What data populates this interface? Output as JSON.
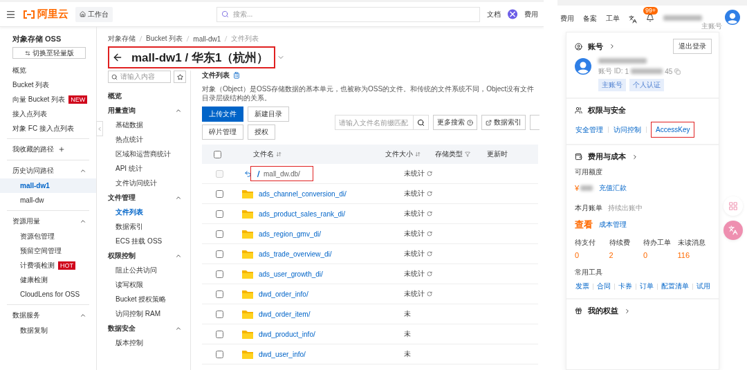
{
  "console": {
    "topbar": {
      "logo": "阿里云",
      "workbench": "工作台",
      "search_placeholder": "搜索...",
      "links": [
        "文档",
        "费用"
      ]
    },
    "sidebar": {
      "title": "对象存储 OSS",
      "switch_button": "切换至轻量版",
      "groups": [
        {
          "kind": "plain",
          "items": [
            {
              "label": "概览",
              "selected": false
            },
            {
              "label": "Bucket 列表",
              "selected": false
            },
            {
              "label": "向量 Bucket 列表",
              "badge": "NEW",
              "selected": false
            },
            {
              "label": "接入点列表",
              "selected": false
            },
            {
              "label": "对象 FC 接入点列表",
              "selected": false
            }
          ]
        },
        {
          "kind": "add",
          "heading": "我收藏的路径"
        },
        {
          "kind": "collapsible",
          "heading": "历史访问路径",
          "expanded": true,
          "items": [
            {
              "label": "mall-dw1",
              "selected": true
            },
            {
              "label": "mall-dw",
              "selected": false
            }
          ]
        },
        {
          "kind": "collapsible",
          "heading": "资源用量",
          "expanded": true,
          "items": [
            {
              "label": "资源包管理",
              "selected": false
            },
            {
              "label": "预留空间管理",
              "selected": false
            },
            {
              "label": "计费项检测",
              "badge": "HOT",
              "selected": false
            },
            {
              "label": "健康检测",
              "selected": false
            },
            {
              "label": "CloudLens for OSS",
              "selected": false
            }
          ]
        },
        {
          "kind": "collapsible",
          "heading": "数据服务",
          "expanded": true,
          "items": [
            {
              "label": "数据复制",
              "selected": false
            }
          ]
        }
      ]
    },
    "breadcrumb": [
      "对象存储",
      "Bucket 列表",
      "mall-dw1",
      "文件列表"
    ],
    "title": {
      "text": "mall-dw1 / 华东1（杭州）",
      "highlighted": true
    },
    "subnav": {
      "search_placeholder": "请输入内容",
      "sections": [
        {
          "title": "概览"
        },
        {
          "title": "用量查询",
          "expanded": true,
          "items": [
            {
              "label": "基础数据",
              "selected": false
            },
            {
              "label": "热点统计",
              "selected": false
            },
            {
              "label": "区域和运营商统计",
              "selected": false
            },
            {
              "label": "API 统计",
              "selected": false
            },
            {
              "label": "文件访问统计",
              "selected": false
            }
          ]
        },
        {
          "title": "文件管理",
          "expanded": true,
          "items": [
            {
              "label": "文件列表",
              "selected": true
            },
            {
              "label": "数据索引",
              "selected": false
            },
            {
              "label": "ECS 挂载 OSS",
              "selected": false
            }
          ]
        },
        {
          "title": "权限控制",
          "expanded": true,
          "items": [
            {
              "label": "阻止公共访问",
              "selected": false
            },
            {
              "label": "读写权限",
              "selected": false
            },
            {
              "label": "Bucket 授权策略",
              "selected": false
            },
            {
              "label": "访问控制 RAM",
              "selected": false
            }
          ]
        },
        {
          "title": "数据安全",
          "expanded": true,
          "items": [
            {
              "label": "版本控制",
              "selected": false
            }
          ]
        }
      ]
    },
    "content": {
      "title": "文件列表",
      "description": "对象（Object）是OSS存储数据的基本单元，也被称为OSS的文件。和传统的文件系统不同，Object没有文件目录层级结构的关系。",
      "buttons": [
        {
          "label": "上传文件",
          "kind": "primary"
        },
        {
          "label": "新建目录",
          "kind": "default"
        },
        {
          "label": "碎片管理",
          "kind": "default"
        },
        {
          "label": "授权",
          "kind": "default"
        }
      ],
      "search_placeholder": "请输入文件名前缀匹配",
      "tools": [
        {
          "label": "更多搜索",
          "kind": "help"
        },
        {
          "label": "数据索引",
          "kind": "external"
        }
      ],
      "table": {
        "header_checked": false,
        "columns": [
          {
            "label": "文件名",
            "kind": "sort"
          },
          {
            "label": "文件大小",
            "kind": "sort"
          },
          {
            "label": "存储类型",
            "kind": "filter"
          },
          {
            "label": "更新时",
            "kind": "plain"
          }
        ],
        "rows": [
          {
            "kind": "parent",
            "name": "mall_dw.db/",
            "size": "未统计",
            "checked": false,
            "disabled": true,
            "highlighted": true
          },
          {
            "kind": "folder",
            "name": "ads_channel_conversion_di/",
            "size": "未统计",
            "checked": false,
            "disabled": false
          },
          {
            "kind": "folder",
            "name": "ads_product_sales_rank_di/",
            "size": "未统计",
            "checked": false,
            "disabled": false
          },
          {
            "kind": "folder",
            "name": "ads_region_gmv_di/",
            "size": "未统计",
            "checked": false,
            "disabled": false
          },
          {
            "kind": "folder",
            "name": "ads_trade_overview_di/",
            "size": "未统计",
            "checked": false,
            "disabled": false
          },
          {
            "kind": "folder",
            "name": "ads_user_growth_di/",
            "size": "未统计",
            "checked": false,
            "disabled": false
          },
          {
            "kind": "folder",
            "name": "dwd_order_info/",
            "size": "未统计",
            "checked": false,
            "disabled": false
          },
          {
            "kind": "folder",
            "name": "dwd_order_item/",
            "size": "未",
            "checked": false,
            "disabled": false
          },
          {
            "kind": "folder",
            "name": "dwd_product_info/",
            "size": "未",
            "checked": false,
            "disabled": false
          },
          {
            "kind": "folder",
            "name": "dwd_user_info/",
            "size": "未",
            "checked": false,
            "disabled": false
          }
        ]
      }
    }
  },
  "account": {
    "topbar": {
      "links": [
        "费用",
        "备案",
        "工单"
      ],
      "notification_badge": "99+",
      "role": "主账号"
    },
    "panel": {
      "account_heading": "账号",
      "logout_button": "退出登录",
      "id_label": "账号 ID:",
      "id_start": "1",
      "id_end": "45",
      "tags": [
        "主账号",
        "个人认证"
      ],
      "security": {
        "heading": "权限与安全",
        "links": [
          {
            "label": "安全管理",
            "highlighted": false
          },
          {
            "label": "访问控制",
            "highlighted": false
          },
          {
            "label": "AccessKey",
            "highlighted": true
          }
        ]
      },
      "billing": {
        "heading": "费用与成本",
        "balance_label": "可用额度",
        "currency": "¥",
        "recharge_link": "充值汇款",
        "bill_label": "本月账单",
        "bill_status": "持续出账中",
        "view_link": "查看",
        "cost_link": "成本管理",
        "stats": [
          {
            "label": "待支付",
            "value": "0"
          },
          {
            "label": "待续费",
            "value": "2"
          },
          {
            "label": "待办工单",
            "value": "0"
          },
          {
            "label": "未读消息",
            "value": "116"
          }
        ],
        "tools_label": "常用工具",
        "tools": [
          "发票",
          "合同",
          "卡券",
          "订单",
          "配置清单",
          "试用"
        ]
      },
      "benefits_heading": "我的权益"
    }
  }
}
